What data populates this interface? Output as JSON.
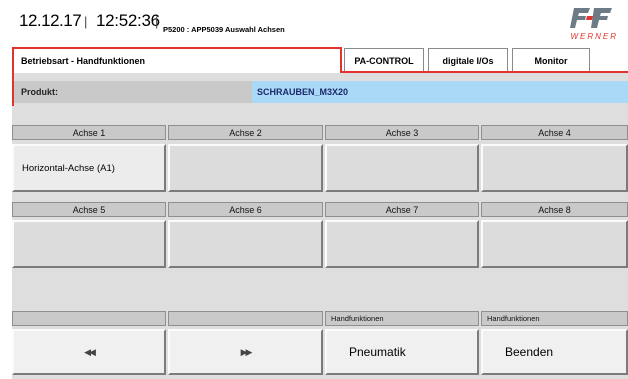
{
  "header": {
    "date": "12.12.17",
    "separator": "|",
    "time": "12:52:36",
    "screen_id": "P5200 : APP5039 Auswahl Achsen",
    "logo_text": "WERNER",
    "logo_color": "#e1342e"
  },
  "tabs": [
    {
      "label": "Betriebsart - Handfunktionen",
      "active": true
    },
    {
      "label": "PA-CONTROL",
      "active": false
    },
    {
      "label": "digitale I/Os",
      "active": false
    },
    {
      "label": "Monitor",
      "active": false
    }
  ],
  "product": {
    "label": "Produkt:",
    "value": "SCHRAUBEN_M3X20"
  },
  "axes_row1": [
    {
      "header": "Achse 1",
      "value": "Horizontal-Achse (A1)"
    },
    {
      "header": "Achse 2",
      "value": ""
    },
    {
      "header": "Achse 3",
      "value": ""
    },
    {
      "header": "Achse 4",
      "value": ""
    }
  ],
  "axes_row2": [
    {
      "header": "Achse 5",
      "value": ""
    },
    {
      "header": "Achse 6",
      "value": ""
    },
    {
      "header": "Achse 7",
      "value": ""
    },
    {
      "header": "Achse 8",
      "value": ""
    }
  ],
  "bottom": {
    "headers": [
      "",
      "",
      "Handfunktionen",
      "Handfunktionen"
    ],
    "prev_icon": "rewind-icon",
    "next_icon": "fast-forward-icon",
    "pneumatik": "Pneumatik",
    "beenden": "Beenden"
  },
  "colors": {
    "accent": "#e1342e",
    "product_highlight": "#aad8f7",
    "panel": "#dedede"
  }
}
